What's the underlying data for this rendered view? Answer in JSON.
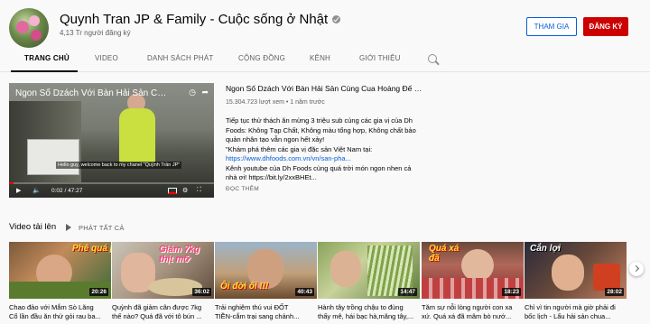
{
  "channel": {
    "name": "Quynh Tran JP & Family - Cuộc sống ở Nhật",
    "subscribers": "4,13 Tr người đăng ký",
    "join_label": "THAM GIA",
    "subscribe_label": "ĐĂNG KÝ"
  },
  "tabs": [
    {
      "label": "TRANG CHỦ",
      "active": true
    },
    {
      "label": "VIDEO"
    },
    {
      "label": "DANH SÁCH PHÁT"
    },
    {
      "label": "CỘNG ĐỒNG"
    },
    {
      "label": "KÊNH"
    },
    {
      "label": "GIỚI THIỆU"
    }
  ],
  "featured": {
    "player_title": "Ngon Số Dzách Với Bàn Hải Sản Cùn...",
    "caption": "Hello guy, welcome back to my chanel  \"Quỳnh Trần JP\"",
    "time": "0:02 / 47:27",
    "progress": 0.02,
    "title": "Ngon Số Dzách Với Bàn Hải Sản Cùng Cua Hoàng Đế Siêu To K...",
    "meta": "15.304.723 lượt xem • 1 năm trước",
    "desc_lines": [
      "Tiếp tục thử thách ăn mừng 3 triệu sub cùng các gia vị của Dh",
      "Foods: Không Tạp Chất, Không màu tổng hợp, Không chất bảo",
      "quản nhân tạo vẫn ngon hết xảy!",
      "\"Khám phá thêm các gia vị đặc sản Việt Nam tại:",
      "https://www.dhfoods.com.vn/vn/san-pha...",
      "Kênh youtube của Dh Foods cùng quá trời món ngon nhen cả",
      "nhà ơi! https://bit.ly/2xxBHEt..."
    ],
    "read_more": "ĐỌC THÊM"
  },
  "uploads": {
    "title": "Video tải lên",
    "play_all": "PHÁT TẤT CẢ",
    "videos": [
      {
        "title1": "Chao đảo với Mắm Sò Lăng",
        "title2": "Cổ lần đầu ăn thử gỏi rau ba...",
        "duration": "20:26",
        "overlay": "Phê quá phê",
        "overlay_color": "#ffe234"
      },
      {
        "title1": "Quỳnh đã giảm cân được 7kg",
        "title2": "thế nào? Quá đã với tô bún ...",
        "duration": "36:02",
        "overlay": "Giảm 7kg thịt mỡ",
        "overlay_color": "#ff3b7a"
      },
      {
        "title1": "Trải nghiệm thú vui ĐỐT",
        "title2": "TIỀN-cắm trại sang chảnh...",
        "duration": "40:43",
        "overlay": "Ôi đời ôi !!!",
        "overlay_color": "#ffe234"
      },
      {
        "title1": "Hành tây trồng chậu to đùng",
        "title2": "thấy mê, hái bạc hà,măng tây,...",
        "duration": "14:47",
        "overlay": "",
        "overlay_color": "#ffffff"
      },
      {
        "title1": "Tăm sự nỗi lòng người con xa",
        "title2": "xứ. Quá xá đã mâm bò nướ...",
        "duration": "18:23",
        "overlay": "Quá xá đã",
        "overlay_color": "#ffe234"
      },
      {
        "title1": "Chỉ vì tin người mà giờ phải đi",
        "title2": "bốc lịch - Lẩu hải sản chua...",
        "duration": "28:02",
        "overlay": "Cắn lợi",
        "overlay_color": "#ffffff"
      }
    ]
  }
}
